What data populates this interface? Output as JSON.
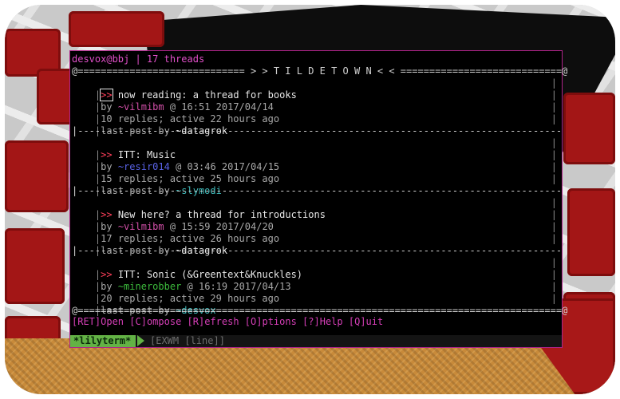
{
  "window": {
    "title": "desvox@bbj | 17 threads",
    "banner": "@============================= > > T I L D E T O W N < < ============================@",
    "separator": "|------------------------------------------------------------------------------------",
    "bottom_border": "@====================================================================================@"
  },
  "threads": [
    {
      "title": "now reading: a thread for books",
      "author": "~vilmibm",
      "author_color": "#d24fa8",
      "time": "@ 16:51 2017/04/14",
      "replies": "10 replies; active 22 hours ago",
      "last_post_by": "~datagrok",
      "selected": true
    },
    {
      "title": "ITT: Music",
      "author": "~resir014",
      "author_color": "#5a63e8",
      "time": "@ 03:46 2017/04/15",
      "replies": "15 replies; active 25 hours ago",
      "last_post_by": "~slymodi",
      "selected": false
    },
    {
      "title": "New here? a thread for introductions",
      "author": "~vilmibm",
      "author_color": "#d24fa8",
      "time": "@ 15:59 2017/04/20",
      "replies": "17 replies; active 26 hours ago",
      "last_post_by": "~datagrok",
      "selected": false
    },
    {
      "title": "ITT: Sonic (&Greentext&Knuckles)",
      "author": "~minerobber",
      "author_color": "#3cba3c",
      "time": "@ 16:19 2017/04/13",
      "replies": "20 replies; active 29 hours ago",
      "last_post_by": "~desvox",
      "selected": false
    }
  ],
  "labels": {
    "by": "by ",
    "last_post_prefix": "last post by ",
    "marker": ">>"
  },
  "keybinds": {
    "open": "[RET]Open",
    "compose": "[C]ompose",
    "refresh": "[R]efresh",
    "options": "[O]ptions",
    "help": "[?]Help",
    "quit": "[Q]uit"
  },
  "modeline": {
    "buffer": "*lilyterm*",
    "mode": "[EXWM [line]]"
  },
  "colors": {
    "accent": "#e04fc8",
    "border": "#b0248a",
    "marker": "#ff3f5a",
    "modeline_green": "#63b245"
  }
}
